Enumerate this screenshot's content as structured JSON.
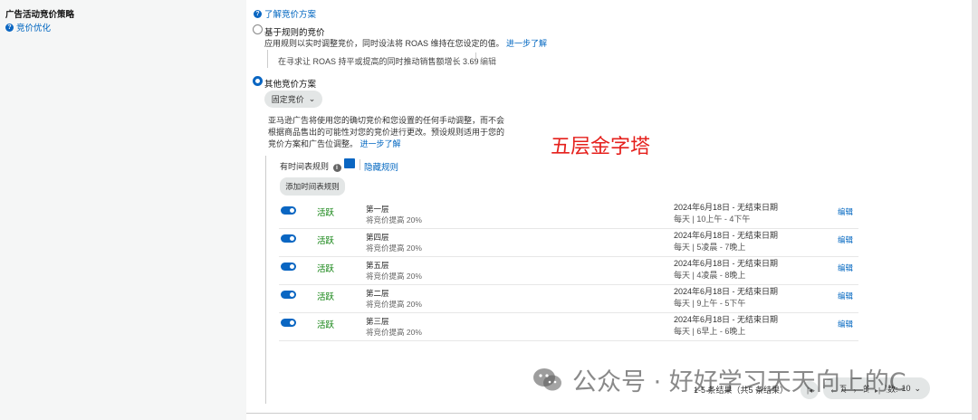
{
  "sidebar": {
    "title": "广告活动竞价策略",
    "link": "竞价优化"
  },
  "main": {
    "learn_link": "了解竞价方案",
    "option_rule": {
      "label": "基于规则的竞价",
      "desc": "应用规则以实时调整竞价，同时设法将 ROAS 维持在您设定的值。",
      "learn_more": "进一步了解",
      "goal_text": "在寻求让 ROAS 持平或提高的同时推动销售额增长 3.69",
      "edit": "编辑"
    },
    "option_other": {
      "label": "其他竞价方案",
      "dropdown_value": "固定竞价",
      "desc_line1": "亚马逊广告将使用您的确切竞价和您设置的任何手动调整，而不会",
      "desc_line2": "根据商品售出的可能性对您的竞价进行更改。预设规则适用于您的",
      "desc_line3": "竞价方案和广告位调整。",
      "learn_more": "进一步了解"
    },
    "schedule": {
      "label": "有时间表规则",
      "hide_rules": "隐藏规则",
      "add_button": "添加时间表规则"
    },
    "rules": [
      {
        "name": "第一层",
        "desc": "将竞价提高 20%",
        "status": "活跃",
        "date": "2024年6月18日 - 无结束日期",
        "time": "每天 | 10上午 - 4下午",
        "edit": "编辑"
      },
      {
        "name": "第四层",
        "desc": "将竞价提高 20%",
        "status": "活跃",
        "date": "2024年6月18日 - 无结束日期",
        "time": "每天 | 5凌晨 - 7晚上",
        "edit": "编辑"
      },
      {
        "name": "第五层",
        "desc": "将竞价提高 20%",
        "status": "活跃",
        "date": "2024年6月18日 - 无结束日期",
        "time": "每天 | 4凌晨 - 8晚上",
        "edit": "编辑"
      },
      {
        "name": "第二层",
        "desc": "将竞价提高 20%",
        "status": "活跃",
        "date": "2024年6月18日 - 无结束日期",
        "time": "每天 | 9上午 - 5下午",
        "edit": "编辑"
      },
      {
        "name": "第三层",
        "desc": "将竞价提高 20%",
        "status": "活跃",
        "date": "2024年6月18日 - 无结束日期",
        "time": "每天 | 6早上 - 6晚上",
        "edit": "编辑"
      }
    ],
    "pagination": {
      "per_page_label": "每页显示的结果数:",
      "per_page_value": "10",
      "count": "1-5 条结果（共5 条结果）"
    }
  },
  "overlay_title": "五层金字塔",
  "watermark": "公众号 · 好好学习天天向上的C",
  "colors": {
    "link": "#0066c0",
    "active": "#067d06",
    "accent": "#0a66c2",
    "annotation": "#e5201c"
  }
}
